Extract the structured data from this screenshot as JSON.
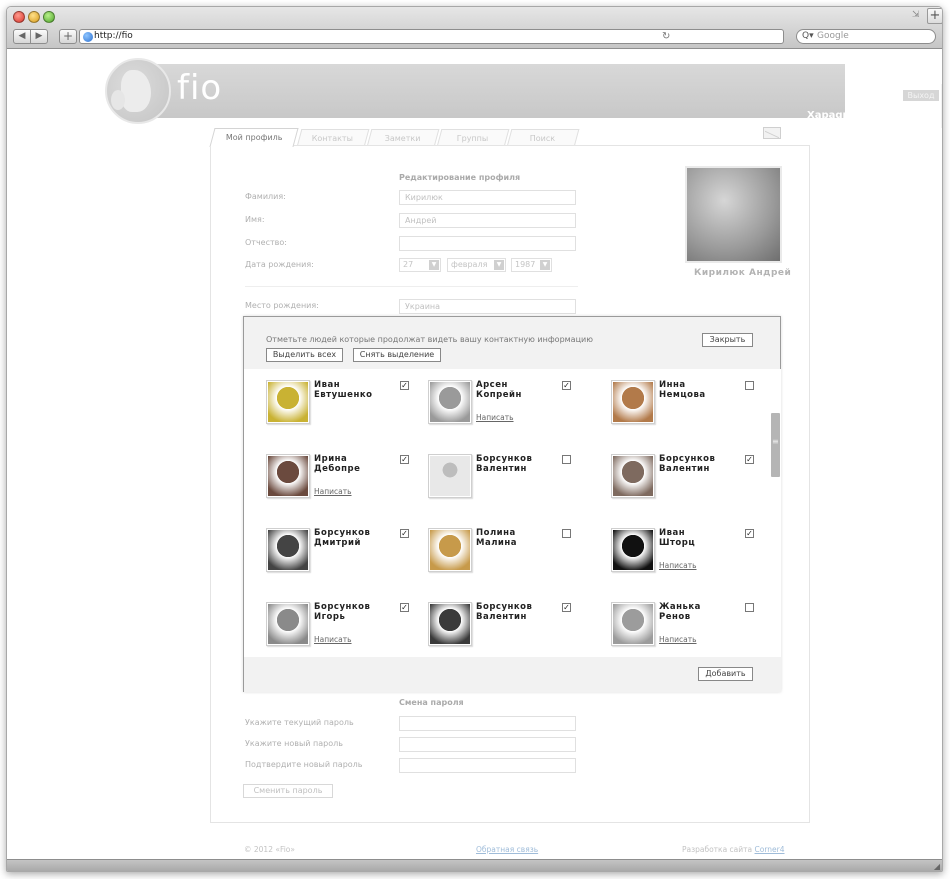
{
  "browser": {
    "url": "http://fio",
    "search_placeholder": "Google"
  },
  "header": {
    "brand": "fio",
    "logout": "Выход",
    "email": "Xapaqpim@corner.com.ua"
  },
  "tabs": [
    {
      "label": "Мой профиль"
    },
    {
      "label": "Контакты"
    },
    {
      "label": "Заметки"
    },
    {
      "label": "Группы"
    },
    {
      "label": "Поиск"
    }
  ],
  "profile": {
    "section_title": "Редактирование профиля",
    "fields": [
      {
        "label": "Фамилия:",
        "value": "Кирилюк"
      },
      {
        "label": "Имя:",
        "value": "Андрей"
      },
      {
        "label": "Отчество:",
        "value": ""
      }
    ],
    "birth_label": "Дата рождения:",
    "birth_day": "27",
    "birth_month": "февраля",
    "birth_year": "1987",
    "birthplace_label": "Место рождения:",
    "birthplace_value": "Украина",
    "name": "Кирилюк Андрей"
  },
  "modal": {
    "note": "Отметьте людей которые продолжат видеть вашу контактную информацию",
    "close": "Закрыть",
    "select_all": "Выделить всех",
    "deselect": "Снять выделение",
    "add": "Добавить",
    "write_label": "Написать",
    "people": [
      {
        "line1": "Иван",
        "line2": "Евтушенко",
        "checked": true,
        "write": false,
        "color": "#c9b233"
      },
      {
        "line1": "Арсен",
        "line2": "Копрейн",
        "checked": true,
        "write": true,
        "color": "#9a9a9a"
      },
      {
        "line1": "Инна",
        "line2": "Немцова",
        "checked": false,
        "write": false,
        "color": "#b27a4a"
      },
      {
        "line1": "Ирина",
        "line2": "Дебопре",
        "checked": true,
        "write": true,
        "color": "#6b4a3e"
      },
      {
        "line1": "Борсунков",
        "line2": "Валентин",
        "checked": false,
        "write": false,
        "color": "#d9d9d9"
      },
      {
        "line1": "Борсунков",
        "line2": "Валентин",
        "checked": true,
        "write": false,
        "color": "#7e6a5f"
      },
      {
        "line1": "Борсунков",
        "line2": "Дмитрий",
        "checked": true,
        "write": false,
        "color": "#444444"
      },
      {
        "line1": "Полина",
        "line2": "Малина",
        "checked": false,
        "write": false,
        "color": "#c79a4a"
      },
      {
        "line1": "Иван",
        "line2": "Шторц",
        "checked": true,
        "write": true,
        "color": "#111111"
      },
      {
        "line1": "Борсунков",
        "line2": "Игорь",
        "checked": true,
        "write": true,
        "color": "#8a8a8a"
      },
      {
        "line1": "Борсунков",
        "line2": "Валентин",
        "checked": true,
        "write": false,
        "color": "#3a3a3a"
      },
      {
        "line1": "Жанька",
        "line2": "Ренов",
        "checked": false,
        "write": true,
        "color": "#9c9c9c"
      }
    ]
  },
  "password": {
    "section_title": "Смена пароля",
    "fields": [
      {
        "label": "Укажите текущий пароль"
      },
      {
        "label": "Укажите новый пароль"
      },
      {
        "label": "Подтвердите новый пароль"
      }
    ],
    "button": "Сменить пароль"
  },
  "footer": {
    "copyright": "© 2012 «Fio»",
    "feedback": "Обратная связь",
    "dev_text": "Разработка сайта",
    "dev_link": "Corner4"
  }
}
